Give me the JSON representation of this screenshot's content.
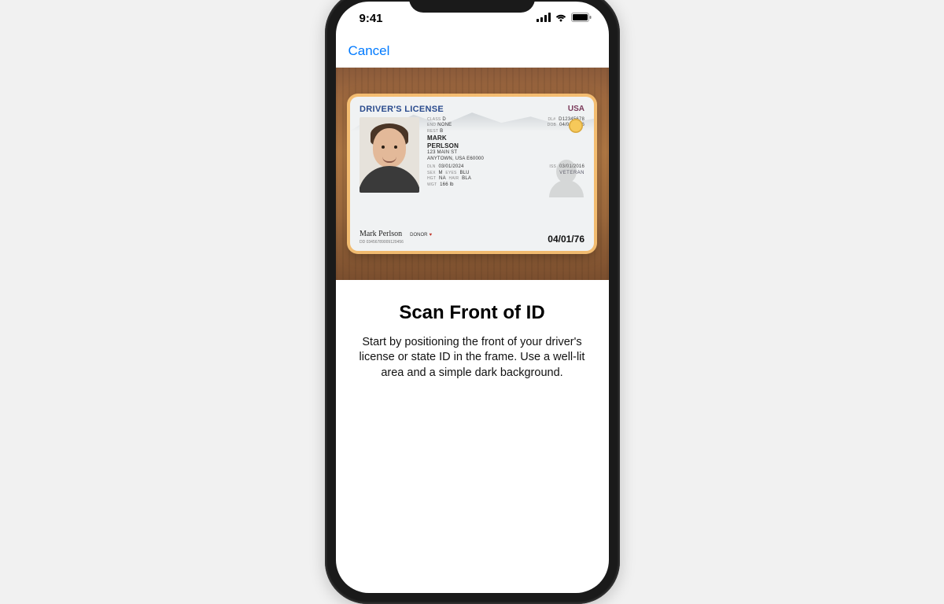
{
  "status": {
    "time": "9:41"
  },
  "nav": {
    "cancel": "Cancel"
  },
  "id_card": {
    "title": "DRIVER'S LICENSE",
    "country": "USA",
    "class_label": "CLASS",
    "class_value": "D",
    "end_label": "END",
    "end_value": "NONE",
    "rest_label": "REST",
    "rest_value": "B",
    "first_name": "MARK",
    "last_name": "PERLSON",
    "addr1": "123 MAIN ST",
    "addr2": "ANYTOWN, USA E60000",
    "dln_label": "DLN",
    "dln_value": "03/01/2024",
    "iss_label": "ISS",
    "iss_value": "03/01/2016",
    "sex_label": "SEX",
    "sex_value": "M",
    "eyes_label": "EYES",
    "eyes_value": "BLU",
    "hgt_label": "HGT",
    "hgt_value": "NA",
    "hair_label": "HAIR",
    "hair_value": "BLA",
    "wgt_label": "WGT",
    "wgt_value": "166 lb",
    "dl_num_label": "DL#",
    "dl_num": "D12345678",
    "dob_label": "DOB",
    "dob": "04/01/1976",
    "big_date": "04/01/76",
    "veteran": "VETERAN",
    "signature": "Mark Perlson",
    "donor": "DONOR",
    "dd_label": "DD",
    "dd": "03456789009120456"
  },
  "instructions": {
    "title": "Scan Front of ID",
    "body": "Start by positioning the front of your driver's license or state ID in the frame. Use a well-lit area and a simple dark background."
  }
}
